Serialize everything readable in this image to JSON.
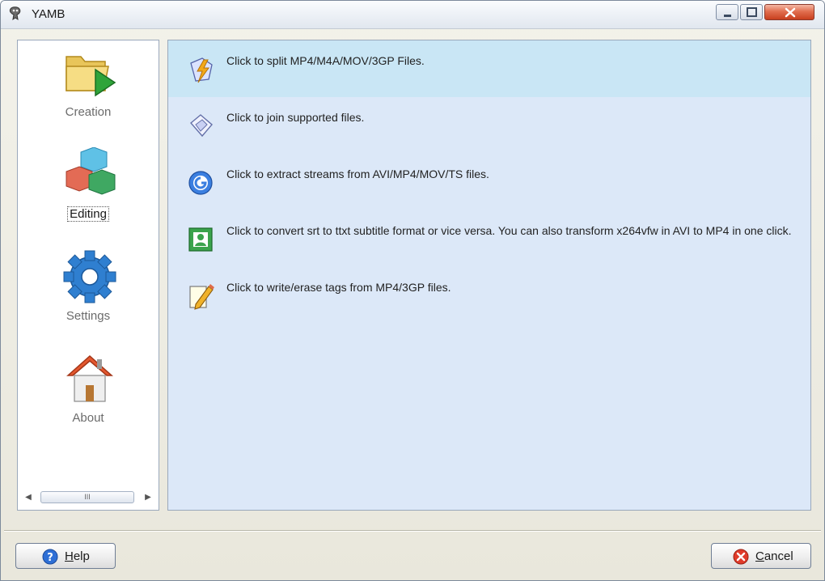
{
  "window": {
    "title": "YAMB"
  },
  "sidebar": {
    "items": [
      {
        "label": "Creation",
        "icon": "folder-play-icon",
        "active": false
      },
      {
        "label": "Editing",
        "icon": "cubes-icon",
        "active": true
      },
      {
        "label": "Settings",
        "icon": "gear-icon",
        "active": false
      },
      {
        "label": "About",
        "icon": "house-icon",
        "active": false
      }
    ],
    "scroll_thumb": "III"
  },
  "tasks": [
    {
      "text": "Click to split MP4/M4A/MOV/3GP Files.",
      "icon": "split-icon",
      "highlighted": true
    },
    {
      "text": "Click to join supported files.",
      "icon": "join-icon",
      "highlighted": false
    },
    {
      "text": "Click to extract streams from AVI/MP4/MOV/TS files.",
      "icon": "extract-icon",
      "highlighted": false
    },
    {
      "text": "Click to convert srt to ttxt subtitle format or vice versa. You can also transform x264vfw in AVI to MP4 in one click.",
      "icon": "convert-icon",
      "highlighted": false
    },
    {
      "text": "Click to write/erase tags from MP4/3GP files.",
      "icon": "tag-pen-icon",
      "highlighted": false
    }
  ],
  "buttons": {
    "help": {
      "label_prefix": "",
      "label_accel": "H",
      "label_rest": "elp",
      "icon": "help-icon"
    },
    "cancel": {
      "label_prefix": "",
      "label_accel": "C",
      "label_rest": "ancel",
      "icon": "cancel-icon"
    }
  },
  "colors": {
    "content_bg": "#dce8f8",
    "highlight_bg": "#c9e6f5",
    "close_button": "#c8401f"
  }
}
